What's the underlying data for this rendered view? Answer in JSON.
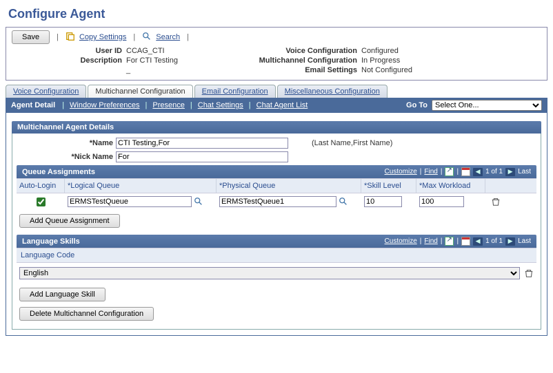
{
  "page_title": "Configure Agent",
  "toolbar": {
    "save": "Save",
    "copy_settings": "Copy Settings",
    "search": "Search"
  },
  "header_info": {
    "left": {
      "user_id_lbl": "User ID",
      "user_id_val": "CCAG_CTI",
      "description_lbl": "Description",
      "description_val": "For CTI Testing"
    },
    "right": {
      "voice_lbl": "Voice Configuration",
      "voice_val": "Configured",
      "multi_lbl": "Multichannel Configuration",
      "multi_val": "In Progress",
      "email_lbl": "Email Settings",
      "email_val": "Not Configured"
    }
  },
  "tabs": {
    "voice": "Voice Configuration",
    "multi": "Multichannel Configuration",
    "email": "Email Configuration",
    "misc": "Miscellaneous Configuration"
  },
  "subnav": {
    "agent_detail": "Agent Detail",
    "window_prefs": "Window Preferences",
    "presence": "Presence",
    "chat_settings": "Chat Settings",
    "chat_agent_list": "Chat Agent List",
    "goto_lbl": "Go To",
    "goto_value": "Select One..."
  },
  "section1": {
    "title": "Multichannel Agent Details",
    "name_lbl": "Name",
    "name_val": "CTI Testing,For",
    "hint": "(Last Name,First Name)",
    "nick_lbl": "Nick Name",
    "nick_val": "For"
  },
  "queue_section": {
    "title": "Queue Assignments",
    "customize": "Customize",
    "find": "Find",
    "pager": "1 of 1",
    "last": "Last",
    "headers": {
      "auto": "Auto-Login",
      "logical": "Logical Queue",
      "physical": "Physical Queue",
      "skill": "Skill Level",
      "max": "Max Workload"
    },
    "row": {
      "auto_checked": true,
      "logical": "ERMSTestQueue",
      "physical": "ERMSTestQueue1",
      "skill": "10",
      "max": "100"
    },
    "add_btn": "Add Queue Assignment"
  },
  "lang_section": {
    "title": "Language Skills",
    "customize": "Customize",
    "find": "Find",
    "pager": "1 of 1",
    "last": "Last",
    "header": "Language Code",
    "value": "English",
    "add_btn": "Add Language Skill"
  },
  "delete_btn": "Delete Multichannel Configuration"
}
